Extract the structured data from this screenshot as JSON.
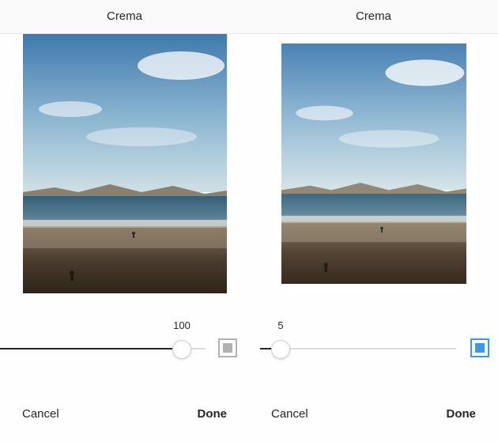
{
  "left": {
    "filter_name": "Crema",
    "intensity": 100,
    "cancel_label": "Cancel",
    "done_label": "Done",
    "frame_enabled": false
  },
  "right": {
    "filter_name": "Crema",
    "intensity": 5,
    "cancel_label": "Cancel",
    "done_label": "Done",
    "frame_enabled": true
  },
  "colors": {
    "accent": "#3897f0"
  }
}
